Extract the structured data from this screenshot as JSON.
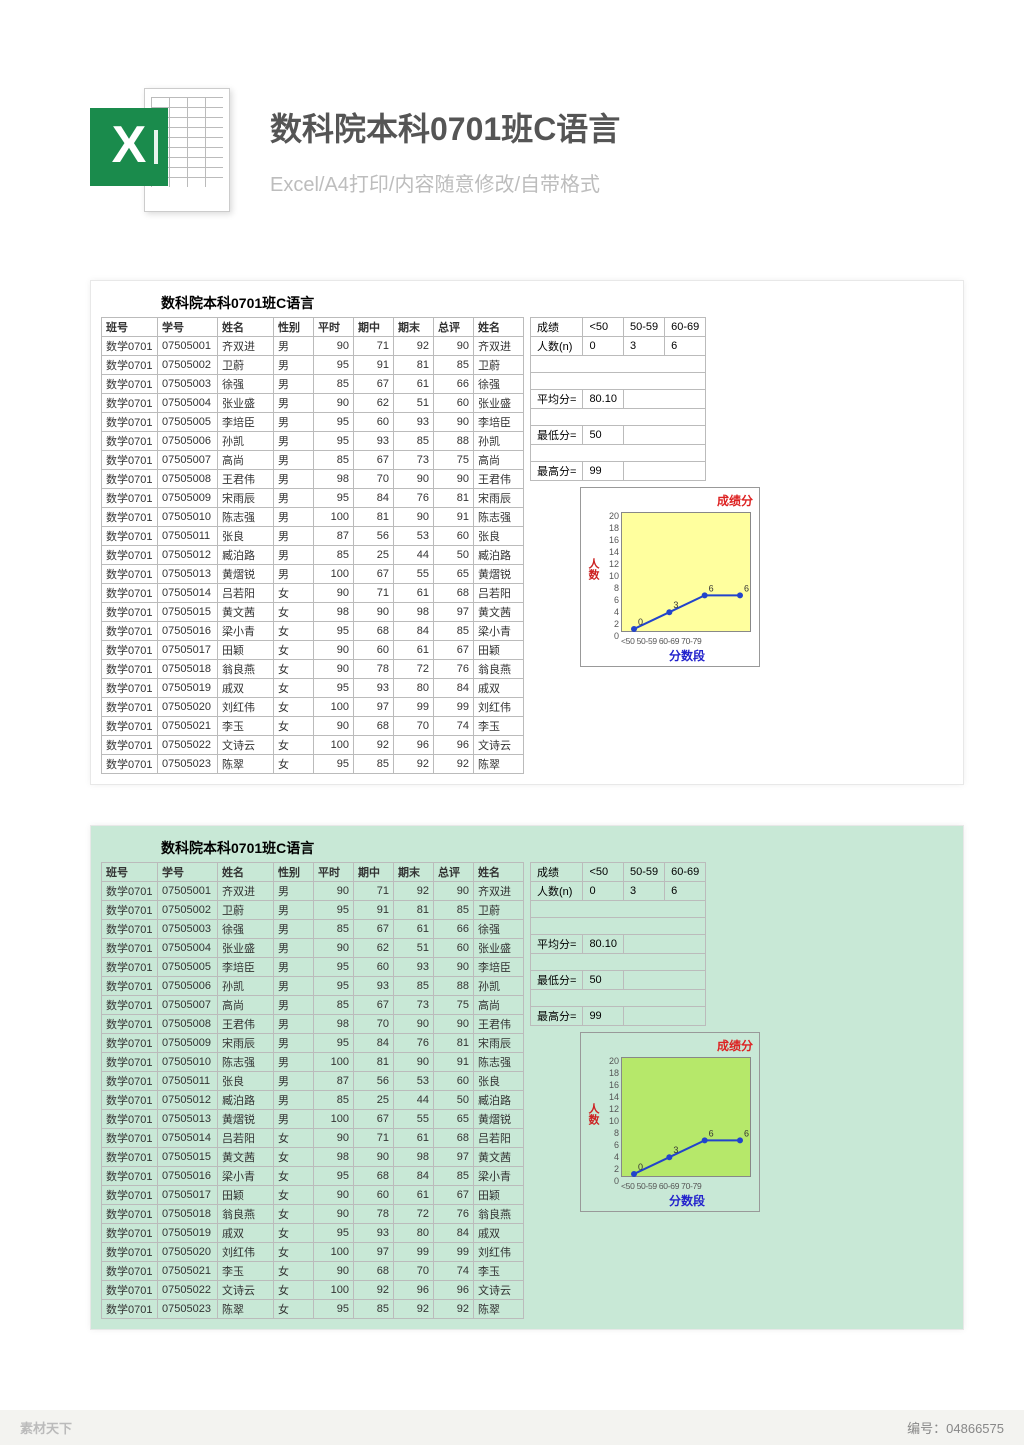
{
  "header": {
    "title": "数科院本科0701班C语言",
    "subtitle": "Excel/A4打印/内容随意修改/自带格式",
    "icon_letter": "X"
  },
  "sheet_title": "数科院本科0701班C语言",
  "columns": [
    "班号",
    "学号",
    "姓名",
    "性别",
    "平时",
    "期中",
    "期末",
    "总评",
    "姓名"
  ],
  "rows": [
    {
      "class": "数学0701",
      "id": "07505001",
      "name": "齐双进",
      "sex": "男",
      "s1": 90,
      "s2": 71,
      "s3": 92,
      "s4": 90,
      "name2": "齐双进"
    },
    {
      "class": "数学0701",
      "id": "07505002",
      "name": "卫蔚",
      "sex": "男",
      "s1": 95,
      "s2": 91,
      "s3": 81,
      "s4": 85,
      "name2": "卫蔚"
    },
    {
      "class": "数学0701",
      "id": "07505003",
      "name": "徐强",
      "sex": "男",
      "s1": 85,
      "s2": 67,
      "s3": 61,
      "s4": 66,
      "name2": "徐强"
    },
    {
      "class": "数学0701",
      "id": "07505004",
      "name": "张业盛",
      "sex": "男",
      "s1": 90,
      "s2": 62,
      "s3": 51,
      "s4": 60,
      "name2": "张业盛"
    },
    {
      "class": "数学0701",
      "id": "07505005",
      "name": "李培臣",
      "sex": "男",
      "s1": 95,
      "s2": 60,
      "s3": 93,
      "s4": 90,
      "name2": "李培臣"
    },
    {
      "class": "数学0701",
      "id": "07505006",
      "name": "孙凯",
      "sex": "男",
      "s1": 95,
      "s2": 93,
      "s3": 85,
      "s4": 88,
      "name2": "孙凯"
    },
    {
      "class": "数学0701",
      "id": "07505007",
      "name": "高尚",
      "sex": "男",
      "s1": 85,
      "s2": 67,
      "s3": 73,
      "s4": 75,
      "name2": "高尚"
    },
    {
      "class": "数学0701",
      "id": "07505008",
      "name": "王君伟",
      "sex": "男",
      "s1": 98,
      "s2": 70,
      "s3": 90,
      "s4": 90,
      "name2": "王君伟"
    },
    {
      "class": "数学0701",
      "id": "07505009",
      "name": "宋雨辰",
      "sex": "男",
      "s1": 95,
      "s2": 84,
      "s3": 76,
      "s4": 81,
      "name2": "宋雨辰"
    },
    {
      "class": "数学0701",
      "id": "07505010",
      "name": "陈志强",
      "sex": "男",
      "s1": 100,
      "s2": 81,
      "s3": 90,
      "s4": 91,
      "name2": "陈志强"
    },
    {
      "class": "数学0701",
      "id": "07505011",
      "name": "张良",
      "sex": "男",
      "s1": 87,
      "s2": 56,
      "s3": 53,
      "s4": 60,
      "name2": "张良"
    },
    {
      "class": "数学0701",
      "id": "07505012",
      "name": "臧泊路",
      "sex": "男",
      "s1": 85,
      "s2": 25,
      "s3": 44,
      "s4": 50,
      "name2": "臧泊路"
    },
    {
      "class": "数学0701",
      "id": "07505013",
      "name": "黄熠锐",
      "sex": "男",
      "s1": 100,
      "s2": 67,
      "s3": 55,
      "s4": 65,
      "name2": "黄熠锐"
    },
    {
      "class": "数学0701",
      "id": "07505014",
      "name": "吕若阳",
      "sex": "女",
      "s1": 90,
      "s2": 71,
      "s3": 61,
      "s4": 68,
      "name2": "吕若阳"
    },
    {
      "class": "数学0701",
      "id": "07505015",
      "name": "黄文茜",
      "sex": "女",
      "s1": 98,
      "s2": 90,
      "s3": 98,
      "s4": 97,
      "name2": "黄文茜"
    },
    {
      "class": "数学0701",
      "id": "07505016",
      "name": "梁小青",
      "sex": "女",
      "s1": 95,
      "s2": 68,
      "s3": 84,
      "s4": 85,
      "name2": "梁小青"
    },
    {
      "class": "数学0701",
      "id": "07505017",
      "name": "田颖",
      "sex": "女",
      "s1": 90,
      "s2": 60,
      "s3": 61,
      "s4": 67,
      "name2": "田颖"
    },
    {
      "class": "数学0701",
      "id": "07505018",
      "name": "翁良燕",
      "sex": "女",
      "s1": 90,
      "s2": 78,
      "s3": 72,
      "s4": 76,
      "name2": "翁良燕"
    },
    {
      "class": "数学0701",
      "id": "07505019",
      "name": "戚双",
      "sex": "女",
      "s1": 95,
      "s2": 93,
      "s3": 80,
      "s4": 84,
      "name2": "戚双"
    },
    {
      "class": "数学0701",
      "id": "07505020",
      "name": "刘红伟",
      "sex": "女",
      "s1": 100,
      "s2": 97,
      "s3": 99,
      "s4": 99,
      "name2": "刘红伟"
    },
    {
      "class": "数学0701",
      "id": "07505021",
      "name": "李玉",
      "sex": "女",
      "s1": 90,
      "s2": 68,
      "s3": 70,
      "s4": 74,
      "name2": "李玉"
    },
    {
      "class": "数学0701",
      "id": "07505022",
      "name": "文诗云",
      "sex": "女",
      "s1": 100,
      "s2": 92,
      "s3": 96,
      "s4": 96,
      "name2": "文诗云"
    },
    {
      "class": "数学0701",
      "id": "07505023",
      "name": "陈翠",
      "sex": "女",
      "s1": 95,
      "s2": 85,
      "s3": 92,
      "s4": 92,
      "name2": "陈翠"
    }
  ],
  "stats": {
    "dist_header": "成绩",
    "dist_count_label": "人数(n)",
    "bins": [
      "<50",
      "50-59",
      "60-69"
    ],
    "counts": [
      0,
      3,
      6
    ],
    "avg_label": "平均分=",
    "avg": "80.10",
    "min_label": "最低分=",
    "min": "50",
    "max_label": "最高分=",
    "max": "99"
  },
  "chart_data": {
    "type": "line",
    "title": "成绩分",
    "ylabel": "人数",
    "xlabel": "分数段",
    "categories": [
      "<50",
      "50-59",
      "60-69",
      "70-79"
    ],
    "values": [
      0,
      3,
      6,
      6
    ],
    "y_ticks": [
      20,
      18,
      16,
      14,
      12,
      10,
      8,
      6,
      4,
      2,
      0
    ]
  },
  "footer": {
    "logo": "素材天下",
    "label": "编号：",
    "id": "04866575"
  }
}
